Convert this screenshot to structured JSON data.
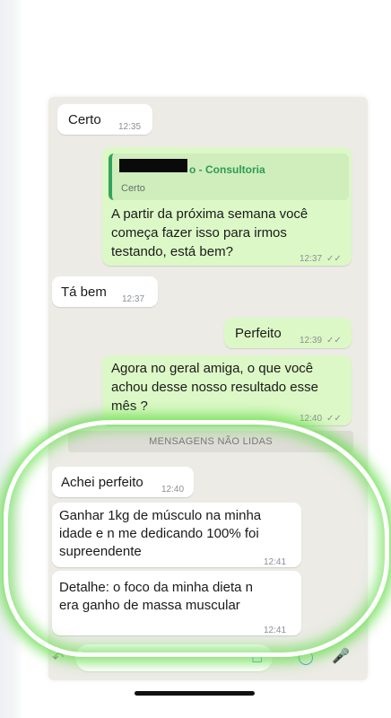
{
  "messages": [
    {
      "text": "Certo",
      "time": "12:35"
    },
    {
      "quote": {
        "sender_suffix": "o - Consultoria",
        "text": "Certo"
      },
      "lines": [
        "A partir da próxima semana você",
        "começa fazer isso para irmos",
        "testando, está bem?"
      ],
      "time": "12:37"
    },
    {
      "text": "Tá bem",
      "time": "12:37"
    },
    {
      "text": "Perfeito",
      "time": "12:39"
    },
    {
      "lines": [
        "Agora no geral amiga, o que você",
        "achou desse nosso resultado esse",
        "mês ?"
      ],
      "time": "12:40"
    },
    {
      "text": "Achei perfeito",
      "time": "12:40"
    },
    {
      "lines": [
        "Ganhar 1kg de músculo na minha",
        "idade e n me dedicando 100% foi",
        "supreendente"
      ],
      "time": "12:41"
    },
    {
      "lines": [
        "Detalhe: o foco da minha dieta n",
        "era ganho de massa muscular"
      ],
      "time": "12:41"
    }
  ],
  "unread_banner": "MENSAGENS NÃO LIDAS",
  "colors": {
    "incoming": "#ffffff",
    "outgoing": "#dcf8c6",
    "highlight": "#68de4e",
    "quote_accent": "#33a35c"
  },
  "icons": [
    "sticker-icon",
    "camera-icon",
    "microphone-icon",
    "emoji-icon"
  ]
}
